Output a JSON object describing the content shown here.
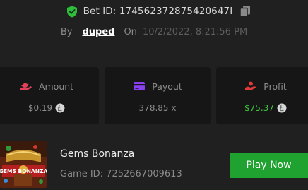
{
  "bet": {
    "id_text": "Bet ID: 174562372875420647I",
    "by_label": "By",
    "username": "duped",
    "on_label": "On",
    "date": "10/2/2022, 8:21:56 PM"
  },
  "stats": {
    "amount": {
      "label": "Amount",
      "value": "$0.19",
      "icon": "hand-money-icon",
      "color": "#e0405a"
    },
    "payout": {
      "label": "Payout",
      "value": "378.85 x",
      "icon": "card-icon",
      "color": "#8a3ff0"
    },
    "profit": {
      "label": "Profit",
      "value": "$75.37",
      "icon": "hand-coins-icon",
      "color": "#e03a3a",
      "value_color": "#3fc63f"
    }
  },
  "game": {
    "name": "Gems Bonanza",
    "id_text": "Game ID: 7252667009613",
    "thumbnail_text": "GEMS BONANZA",
    "play_label": "Play Now"
  },
  "colors": {
    "background": "#202020",
    "card": "#161616",
    "verified": "#2fbd3c",
    "play_button": "#1fa22f"
  }
}
